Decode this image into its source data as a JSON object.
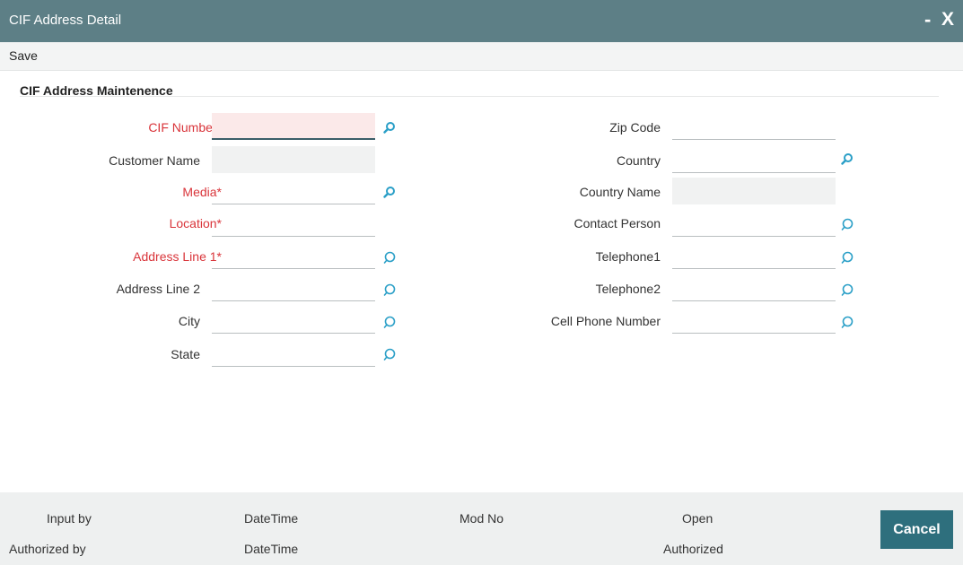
{
  "window": {
    "title": "CIF Address Detail",
    "minimize": "-",
    "close": "X"
  },
  "menu": {
    "save": "Save"
  },
  "section": {
    "title": "CIF Address Maintenence"
  },
  "left_fields": [
    {
      "label": "CIF Number",
      "required": "*",
      "value": ""
    },
    {
      "label": "Customer Name",
      "value": ""
    },
    {
      "label": "Media",
      "required": "*",
      "value": ""
    },
    {
      "label": "Location",
      "required": "*",
      "value": ""
    },
    {
      "label": "Address Line 1",
      "required": "*",
      "value": ""
    },
    {
      "label": "Address Line 2",
      "value": ""
    },
    {
      "label": "City",
      "value": ""
    },
    {
      "label": "State",
      "value": ""
    }
  ],
  "right_fields": [
    {
      "label": "Zip Code",
      "value": ""
    },
    {
      "label": "Country",
      "value": ""
    },
    {
      "label": "Country Name",
      "value": ""
    },
    {
      "label": "Contact Person",
      "value": ""
    },
    {
      "label": "Telephone1",
      "value": ""
    },
    {
      "label": "Telephone2",
      "value": ""
    },
    {
      "label": "Cell Phone Number",
      "value": ""
    }
  ],
  "footer": {
    "input_by": "Input by",
    "authorized_by": "Authorized by",
    "datetime1": "DateTime",
    "datetime2": "DateTime",
    "mod_no": "Mod No",
    "open": "Open",
    "authorized": "Authorized",
    "cancel": "Cancel"
  },
  "colors": {
    "titlebar": "#5d7f86",
    "required": "#d9343a",
    "icon": "#2a9fc7",
    "cancel": "#2e6f7d"
  }
}
